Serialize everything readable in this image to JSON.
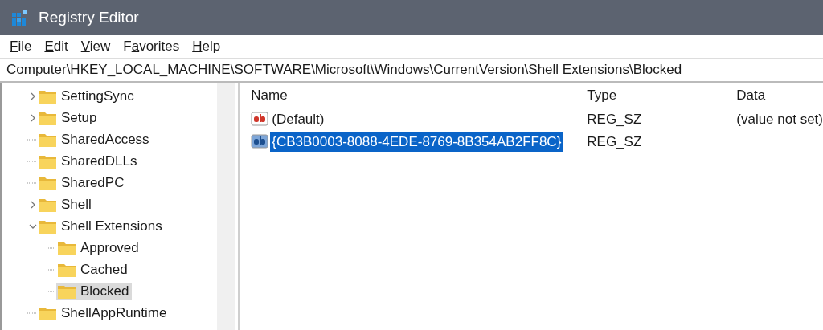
{
  "window": {
    "title": "Registry Editor"
  },
  "menu": [
    {
      "key": "F",
      "after": "ile"
    },
    {
      "key": "E",
      "after": "dit"
    },
    {
      "key": "V",
      "after": "iew"
    },
    {
      "before": "F",
      "key": "a",
      "after": "vorites"
    },
    {
      "key": "H",
      "after": "elp"
    }
  ],
  "address": "Computer\\HKEY_LOCAL_MACHINE\\SOFTWARE\\Microsoft\\Windows\\CurrentVersion\\Shell Extensions\\Blocked",
  "tree": [
    {
      "label": "SettingSync",
      "kind": "branch",
      "expanded": false,
      "selected": false
    },
    {
      "label": "Setup",
      "kind": "branch",
      "expanded": false,
      "selected": false
    },
    {
      "label": "SharedAccess",
      "kind": "leaf",
      "selected": false
    },
    {
      "label": "SharedDLLs",
      "kind": "leaf",
      "selected": false
    },
    {
      "label": "SharedPC",
      "kind": "leaf",
      "selected": false
    },
    {
      "label": "Shell",
      "kind": "branch",
      "expanded": false,
      "selected": false
    },
    {
      "label": "Shell Extensions",
      "kind": "branch",
      "expanded": true,
      "selected": false,
      "children": [
        {
          "label": "Approved",
          "kind": "leaf",
          "selected": false
        },
        {
          "label": "Cached",
          "kind": "leaf",
          "selected": false
        },
        {
          "label": "Blocked",
          "kind": "leaf",
          "selected": true
        }
      ]
    },
    {
      "label": "ShellAppRuntime",
      "kind": "leaf",
      "selected": false
    }
  ],
  "table": {
    "columns": [
      "Name",
      "Type",
      "Data"
    ],
    "rows": [
      {
        "name": "(Default)",
        "type": "REG_SZ",
        "data": "(value not set)",
        "selected": false
      },
      {
        "name": "{CB3B0003-8088-4EDE-8769-8B354AB2FF8C}",
        "type": "REG_SZ",
        "selected": true
      }
    ]
  }
}
